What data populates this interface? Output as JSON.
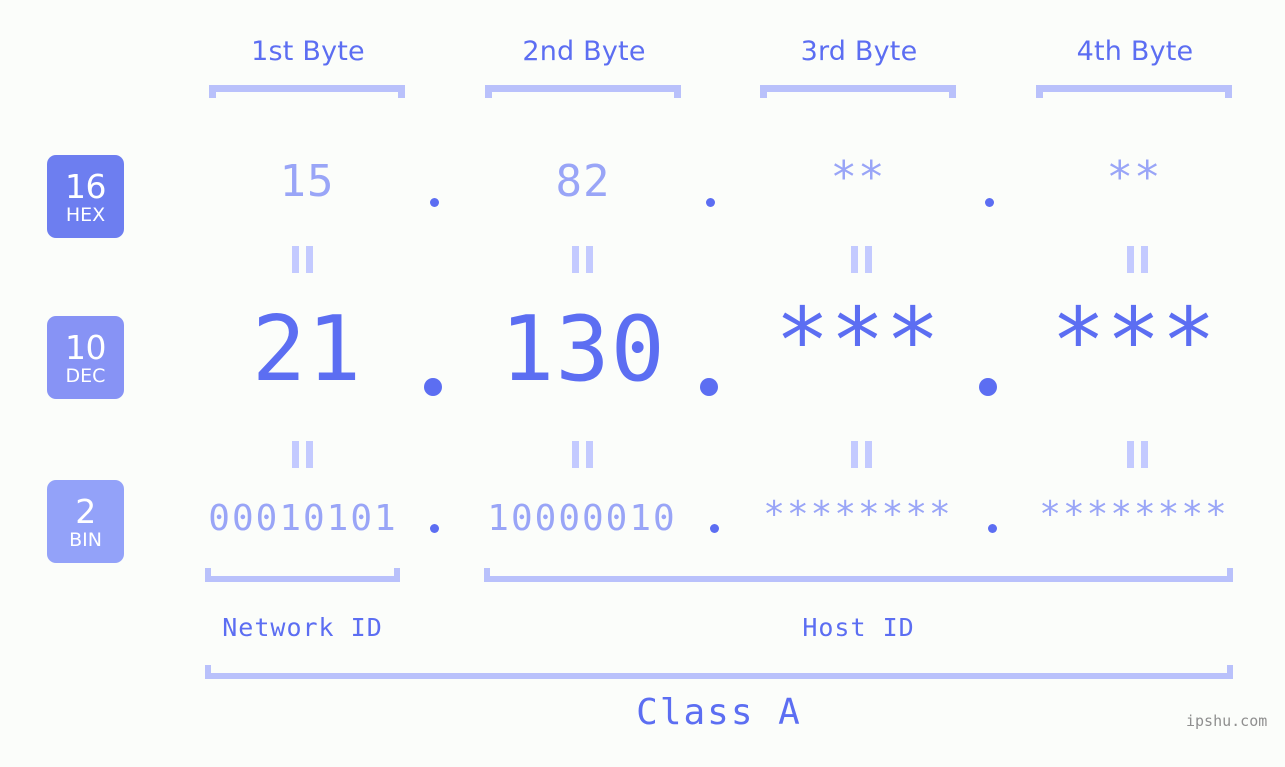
{
  "colors": {
    "background": "#fbfdfa",
    "accent_strong": "#5c6ef2",
    "accent_light": "#99a5f7",
    "bracket": "#b9c1fb",
    "equals": "#c3caff",
    "badge_hex": "#6d7ef0",
    "badge_dec": "#8793f5",
    "badge_bin": "#93a2f9",
    "watermark": "#8f8f8f"
  },
  "byte_headers": [
    {
      "label": "1st Byte"
    },
    {
      "label": "2nd Byte"
    },
    {
      "label": "3rd Byte"
    },
    {
      "label": "4th Byte"
    }
  ],
  "bases": [
    {
      "number": "16",
      "name": "HEX"
    },
    {
      "number": "10",
      "name": "DEC"
    },
    {
      "number": "2",
      "name": "BIN"
    }
  ],
  "rows": {
    "hex": {
      "base": "16",
      "base_name": "HEX",
      "values": [
        "15",
        "82",
        "**",
        "**"
      ]
    },
    "dec": {
      "base": "10",
      "base_name": "DEC",
      "values": [
        "21",
        "130",
        "***",
        "***"
      ]
    },
    "bin": {
      "base": "2",
      "base_name": "BIN",
      "values": [
        "00010101",
        "10000010",
        "********",
        "********"
      ]
    }
  },
  "separators": {
    "dot": "."
  },
  "equals_glyph": "||",
  "segments": {
    "network_id": "Network ID",
    "host_id": "Host ID",
    "class": "Class A"
  },
  "watermark": "ipshu.com"
}
